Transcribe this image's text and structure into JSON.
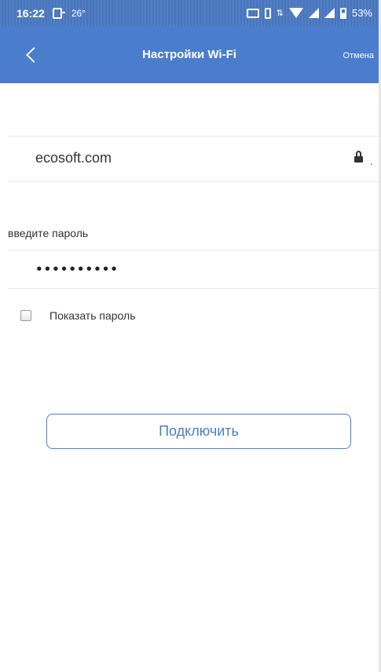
{
  "status_bar": {
    "time": "16:22",
    "temperature": "26°",
    "battery": "53%",
    "icons": [
      "sim-card-icon",
      "cast-icon",
      "vibrate-icon",
      "data-arrows-icon",
      "wifi-icon",
      "signal-icon",
      "battery-icon"
    ]
  },
  "header": {
    "title": "Настройки Wi-Fi",
    "cancel_label": "Отмена",
    "back_icon": "chevron-left-icon",
    "color": "#4a7dcb"
  },
  "network": {
    "ssid": "ecosoft.com",
    "lock_icon": "lock-icon",
    "lock_suffix": "."
  },
  "password": {
    "label": "введите пароль",
    "value": "••••••••••"
  },
  "show_password": {
    "label": "Показать пароль",
    "checked": false
  },
  "connect_button": {
    "label": "Подключить"
  }
}
